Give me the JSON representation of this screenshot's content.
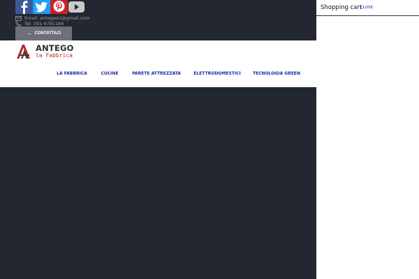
{
  "social": [
    {
      "name": "facebook-icon",
      "color": "#3b5998"
    },
    {
      "name": "twitter-icon",
      "color": "#1da1f2"
    },
    {
      "name": "pinterest-icon",
      "color": "#cb2027"
    },
    {
      "name": "youtube-icon",
      "color": "#c9c9c9"
    }
  ],
  "contact": {
    "email": "Email: antegosrl@gmail.com",
    "tel": "Tel: 091 6791184",
    "button_label": "CONTATTACI"
  },
  "logo": {
    "name": "ANTEGO",
    "subtitle": "la Fabbrica"
  },
  "nav": [
    {
      "label": "LA FABBRICA"
    },
    {
      "label": "CUCINE"
    },
    {
      "label": "PARETE ATTREZZATA"
    },
    {
      "label": "ELETTRODOMESTICI"
    },
    {
      "label": "TECNOLOGIA GREEN"
    }
  ],
  "cart": {
    "title": "Shopping cart",
    "close_label": "CLOSE"
  },
  "colors": {
    "dark_bg": "#232731",
    "nav_link": "#1a2aa8",
    "brand_red": "#c0282b"
  }
}
